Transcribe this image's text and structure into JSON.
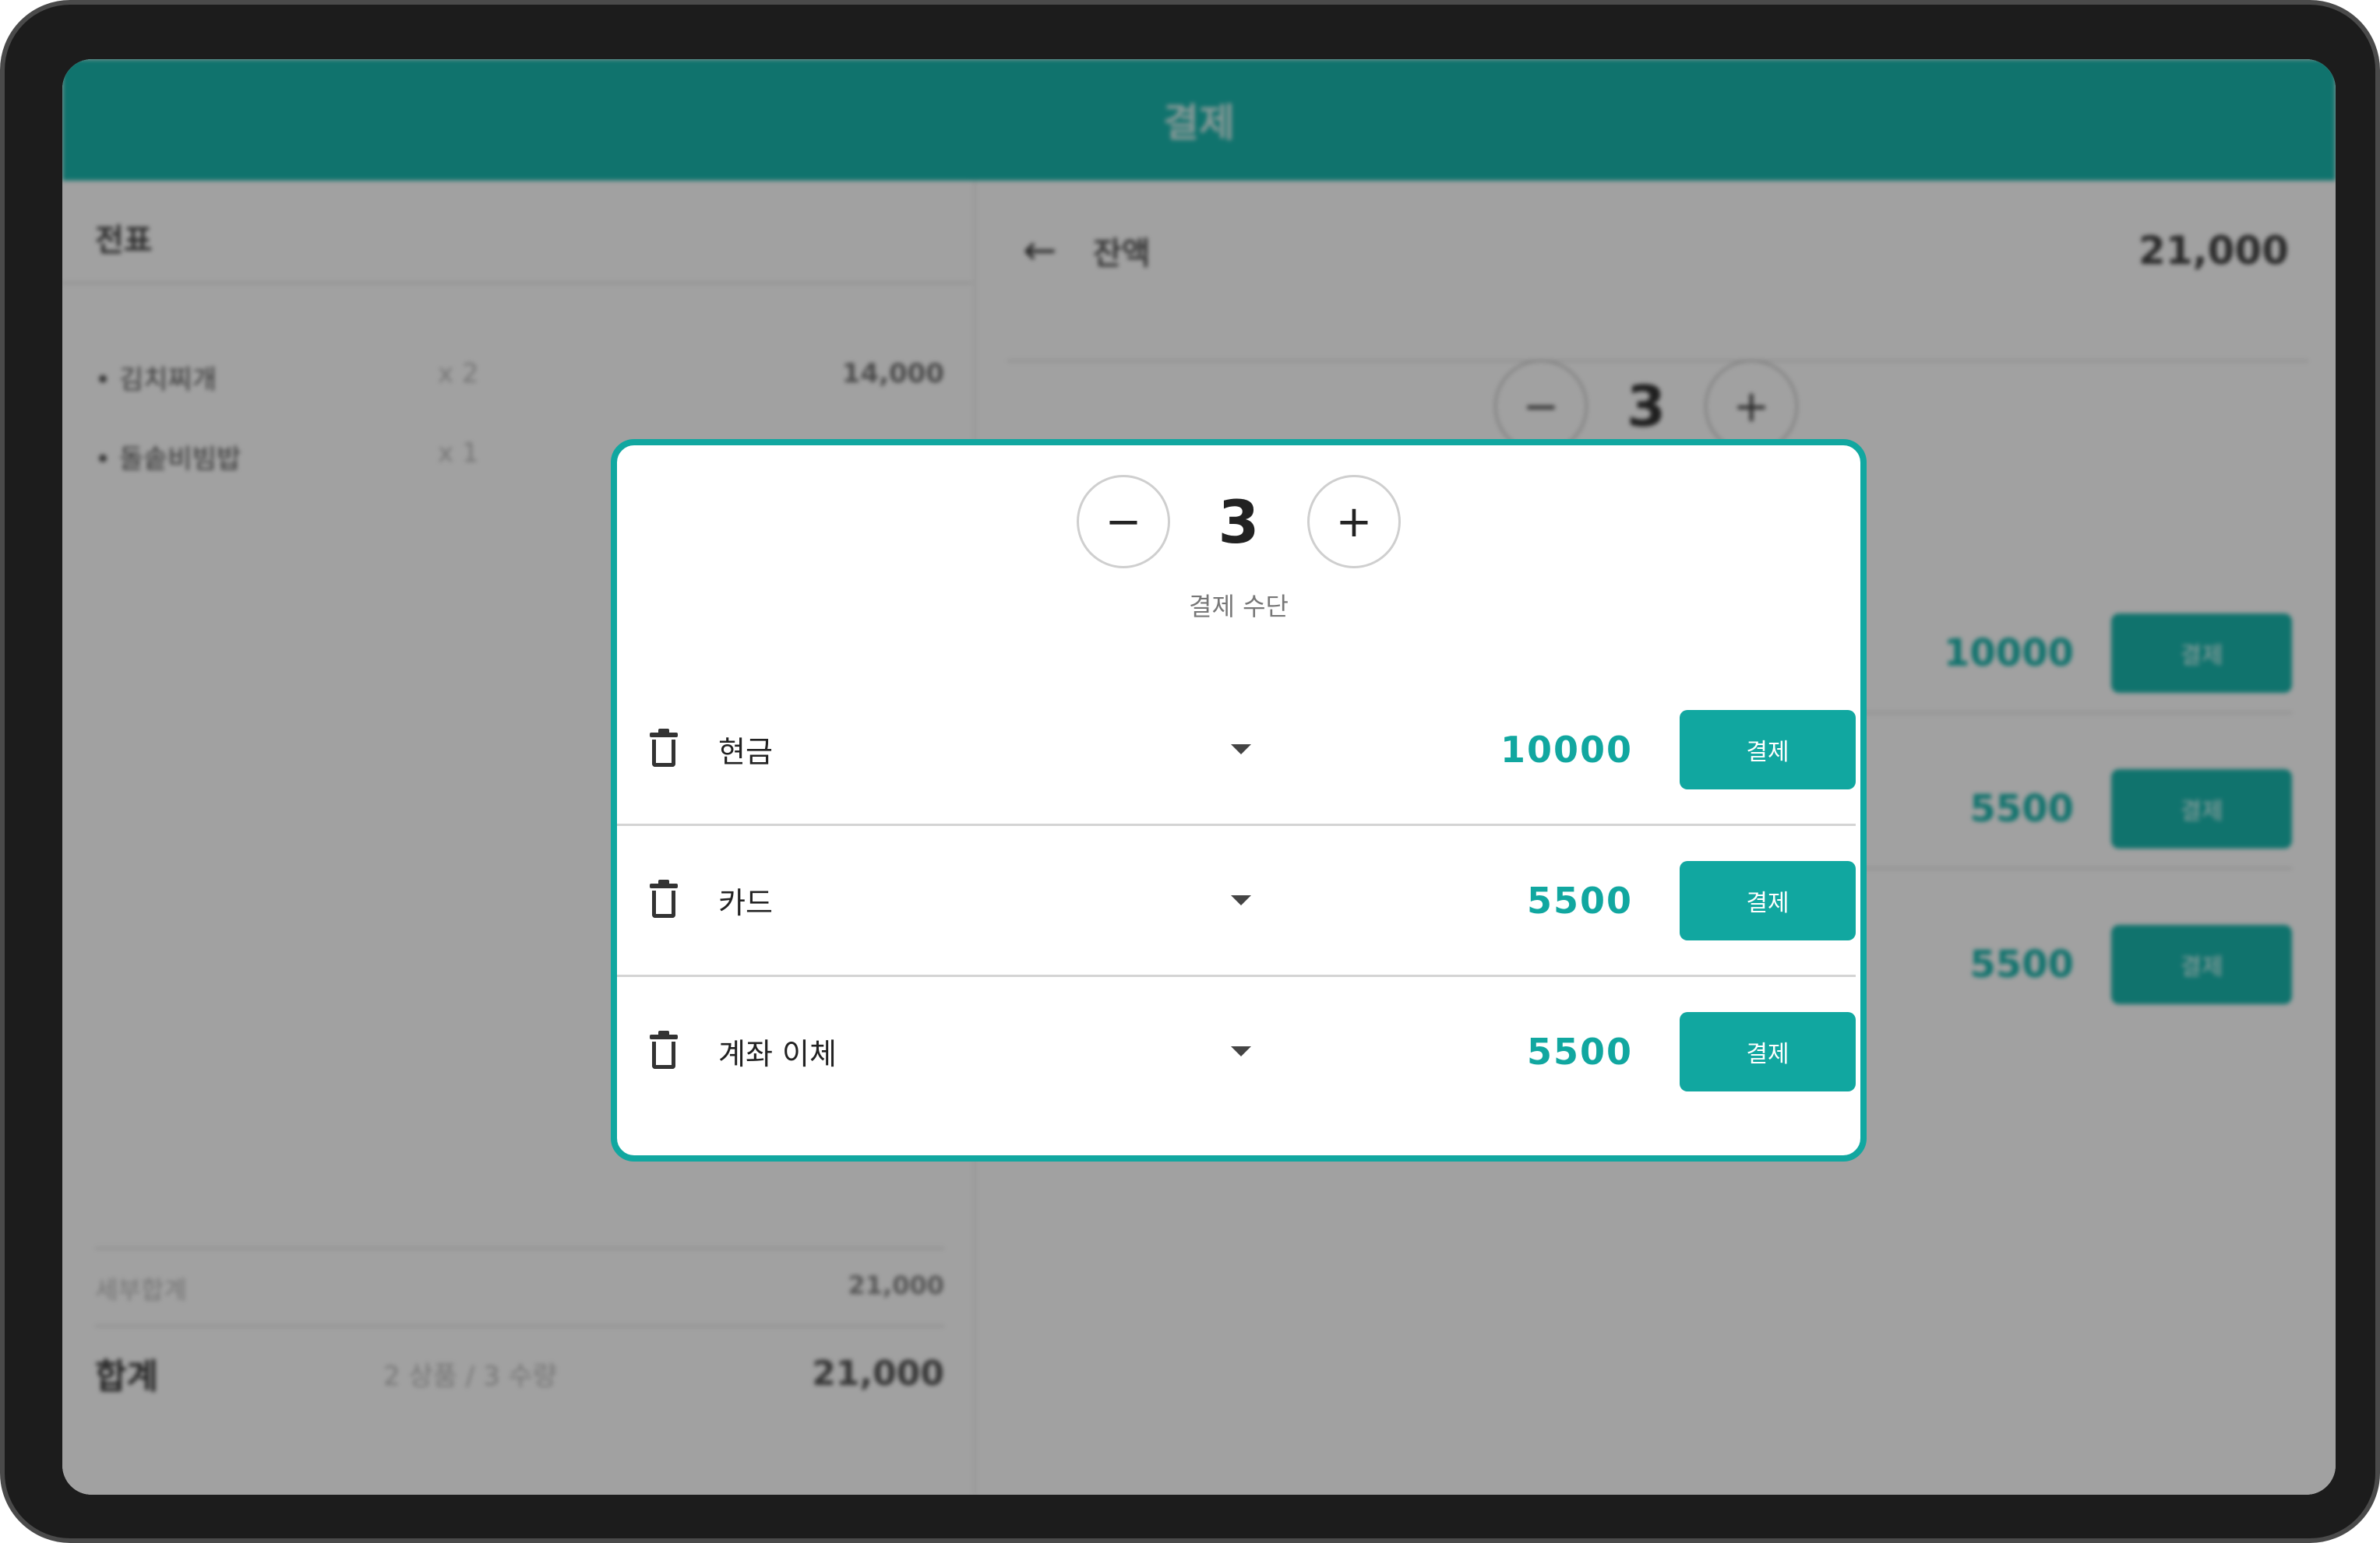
{
  "app": {
    "header_title": "결제"
  },
  "receipt": {
    "title": "전표",
    "items": [
      {
        "name": "• 김치찌개",
        "qty": "x 2",
        "price": "14,000"
      },
      {
        "name": "• 돌솥비빔밥",
        "qty": "x 1",
        "price": ""
      }
    ],
    "subtotal_label": "세부합계",
    "subtotal_value": "21,000",
    "total_label": "합계",
    "total_meta": "2 상품 / 3 수량",
    "total_value": "21,000"
  },
  "balance": {
    "label": "잔액",
    "value": "21,000",
    "back_icon": "←"
  },
  "background_split": {
    "count": "3",
    "minus": "−",
    "plus": "+",
    "rows": [
      {
        "amount": "10000",
        "button": "결제"
      },
      {
        "amount": "5500",
        "button": "결제"
      },
      {
        "amount": "5500",
        "button": "결제"
      }
    ]
  },
  "modal": {
    "stepper": {
      "minus_label": "−",
      "count": "3",
      "plus_label": "+"
    },
    "caption": "결제 수단",
    "rows": [
      {
        "method": "현금",
        "amount": "10000",
        "button": "결제"
      },
      {
        "method": "카드",
        "amount": "5500",
        "button": "결제"
      },
      {
        "method": "계좌 이체",
        "amount": "5500",
        "button": "결제"
      }
    ],
    "accent_color": "#11a7a0"
  }
}
